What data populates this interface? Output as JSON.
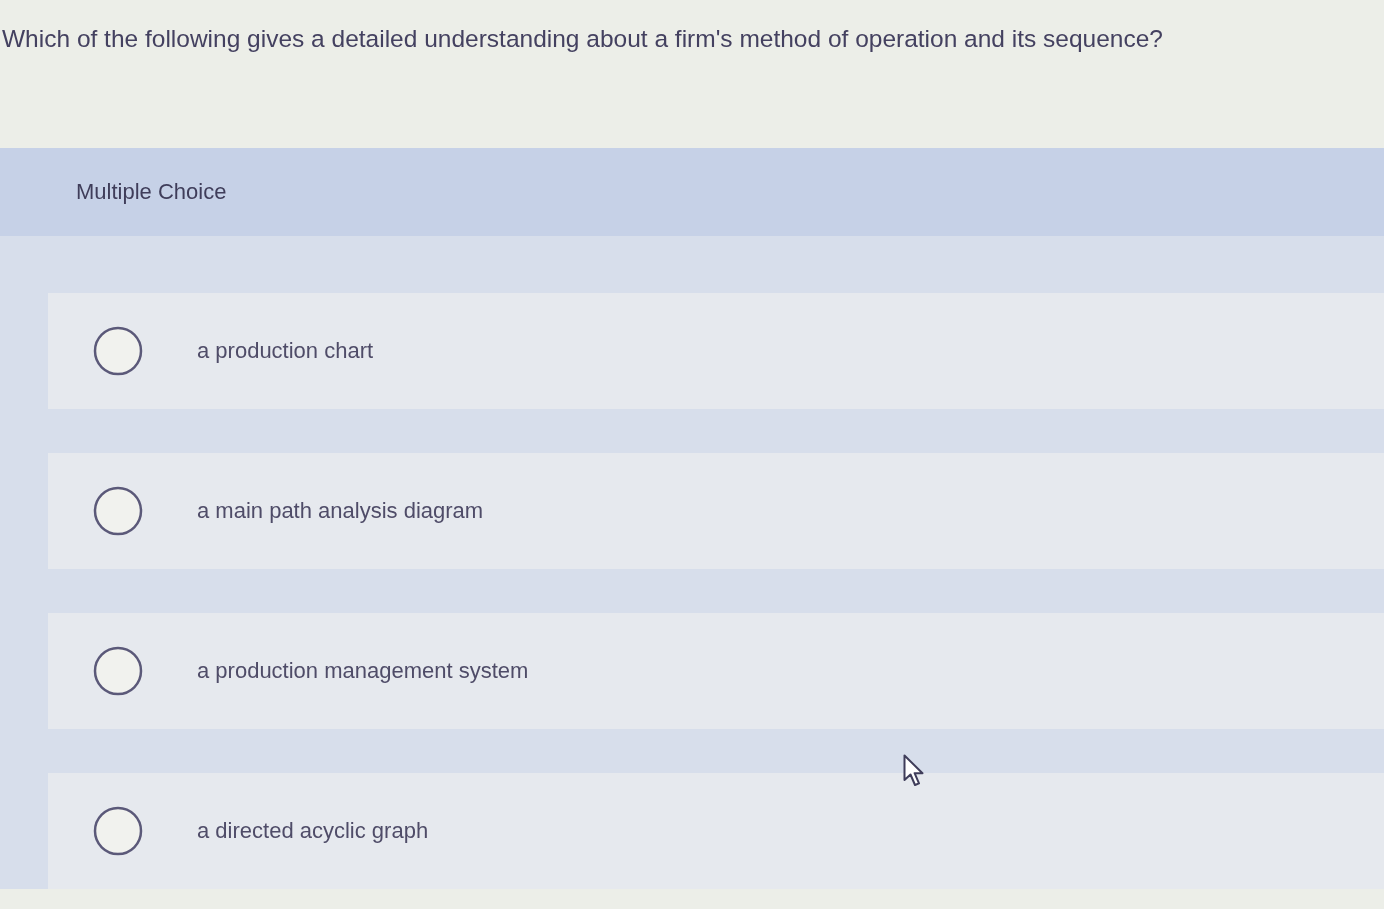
{
  "question": {
    "text": "Which of the following gives a detailed understanding about a firm's method of operation and its sequence?"
  },
  "answer_panel": {
    "heading": "Multiple Choice",
    "options": [
      {
        "label": "a production chart",
        "selected": false
      },
      {
        "label": "a main path analysis diagram",
        "selected": false
      },
      {
        "label": "a production management system",
        "selected": false
      },
      {
        "label": "a directed acyclic graph",
        "selected": false
      }
    ]
  }
}
